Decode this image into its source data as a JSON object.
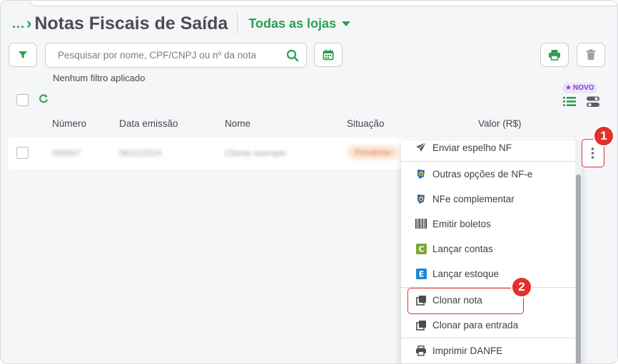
{
  "header": {
    "breadcrumb": "...",
    "title": "Notas Fiscais de Saída",
    "store_selector": "Todas as lojas"
  },
  "search": {
    "placeholder": "Pesquisar por nome, CPF/CNPJ ou nº da nota",
    "value": ""
  },
  "filter_status": "Nenhum filtro aplicado",
  "new_badge": "NOVO",
  "table": {
    "columns": [
      "Número",
      "Data emissão",
      "Nome",
      "Situação",
      "Valor (R$)"
    ],
    "rows": [
      {
        "numero": "000007",
        "data": "06/11/2024",
        "nome": "Cliente exemplo",
        "situacao": "Pendente"
      }
    ]
  },
  "menu": {
    "items": [
      {
        "label": "Enviar espelho NF",
        "icon": "send-icon"
      },
      {
        "label": "Outras opções de NF-e",
        "icon": "nfe-icon"
      },
      {
        "label": "NFe complementar",
        "icon": "nfe-icon"
      },
      {
        "label": "Emitir boletos",
        "icon": "barcode-icon"
      },
      {
        "label": "Lançar contas",
        "icon": "contas-icon"
      },
      {
        "label": "Lançar estoque",
        "icon": "estoque-icon"
      },
      {
        "label": "Clonar nota",
        "icon": "clone-icon"
      },
      {
        "label": "Clonar para entrada",
        "icon": "clone-icon"
      },
      {
        "label": "Imprimir DANFE",
        "icon": "print-icon"
      }
    ]
  },
  "callouts": [
    "1",
    "2"
  ],
  "colors": {
    "brand_green": "#2e9e4f",
    "callout_red": "#e3302d",
    "new_purple": "#7b3fd6",
    "contas_green": "#7ea83c",
    "estoque_blue": "#1e88d2"
  }
}
